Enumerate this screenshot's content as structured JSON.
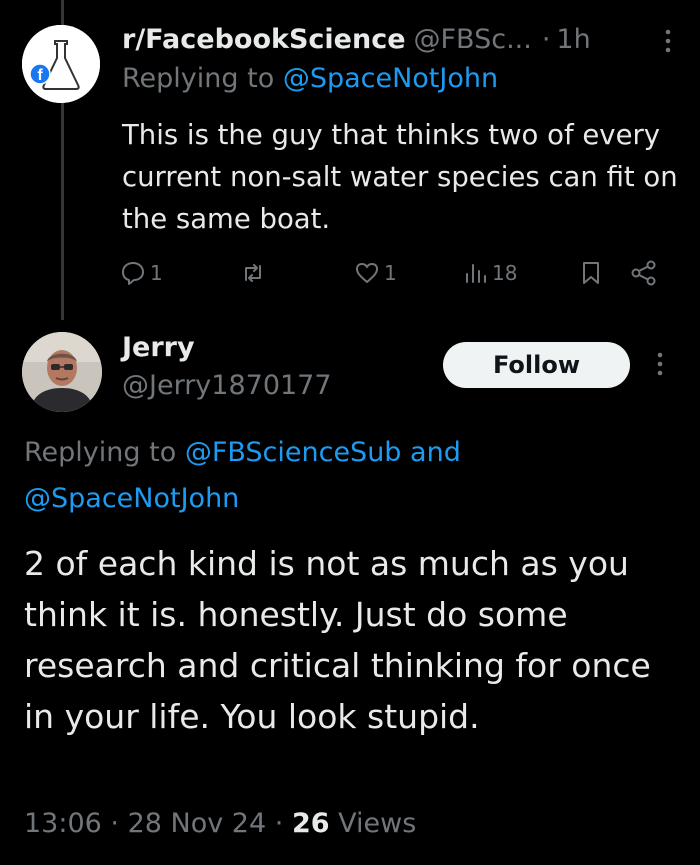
{
  "tweet1": {
    "display_name": "r/FacebookScience",
    "handle": "@FBSc...",
    "separator": "·",
    "time": "1h",
    "replying_prefix": "Replying to",
    "replying_to": "@SpaceNotJohn",
    "text": "This is the guy that thinks two of every current non-salt water species can fit on the same boat.",
    "actions": {
      "reply_count": "1",
      "repost_count": "",
      "like_count": "1",
      "views_count": "18"
    }
  },
  "tweet2": {
    "display_name": "Jerry",
    "handle": "@Jerry1870177",
    "follow_label": "Follow",
    "replying_prefix": "Replying to",
    "replying_to_1": "@FBScienceSub",
    "replying_and": "and",
    "replying_to_2": "@SpaceNotJohn",
    "text": "2 of each kind is not as much as you think it is. honestly. Just do some research and critical thinking for once in your life. You look stupid.",
    "time": "13:06",
    "date": "28 Nov 24",
    "separator": "·",
    "views_count": "26",
    "views_label": "Views"
  },
  "icons": {
    "avatar1": "flask-facebook-logo-avatar",
    "avatar2": "user-photo-avatar",
    "reply": "reply-icon",
    "repost": "repost-icon",
    "like": "like-icon",
    "views": "views-icon",
    "bookmark": "bookmark-icon",
    "share": "share-icon",
    "more": "more-icon"
  },
  "colors": {
    "background": "#000000",
    "text_primary": "#e7e9ea",
    "text_secondary": "#71767b",
    "link": "#1d9bf0",
    "follow_bg": "#eff3f4",
    "facebook_blue": "#1877f2"
  }
}
